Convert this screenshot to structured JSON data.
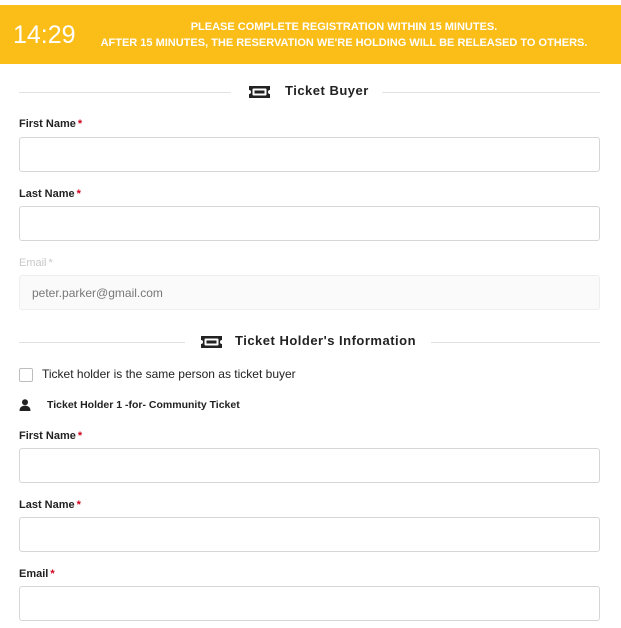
{
  "banner": {
    "timer": "14:29",
    "notice_line1": "PLEASE COMPLETE REGISTRATION WITHIN 15 MINUTES.",
    "notice_line2": "AFTER 15 MINUTES, THE RESERVATION WE'RE HOLDING WILL BE RELEASED TO OTHERS.",
    "color": "#fbbd17"
  },
  "buyer": {
    "title": "Ticket Buyer",
    "icon": "ticket-icon",
    "first_name_label": "First Name",
    "first_name_value": "",
    "last_name_label": "Last Name",
    "last_name_value": "",
    "email_label": "Email",
    "email_value": "peter.parker@gmail.com"
  },
  "holder": {
    "title": "Ticket Holder's Information",
    "icon": "ticket-icon",
    "same_person_label": "Ticket holder is the same person as ticket buyer",
    "same_person_checked": false,
    "holder_heading": "Ticket Holder 1 -for- Community Ticket",
    "holder_icon": "person-icon",
    "first_name_label": "First Name",
    "first_name_value": "",
    "last_name_label": "Last Name",
    "last_name_value": "",
    "email_label": "Email",
    "email_value": ""
  },
  "required_marker": "*",
  "required_color": "#d0021b"
}
